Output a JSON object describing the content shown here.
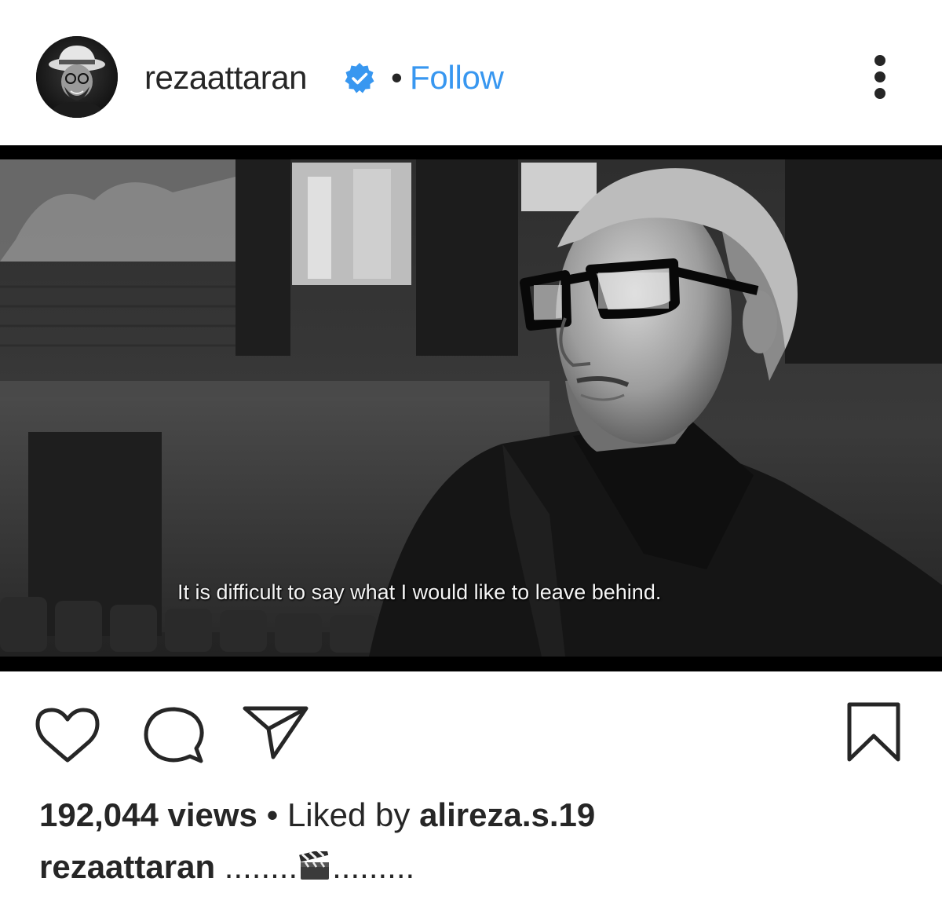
{
  "header": {
    "username": "rezaattaran",
    "verified": true,
    "separator": "•",
    "follow_label": "Follow",
    "more_icon": "more-vertical-icon",
    "accent_color": "#3897f0"
  },
  "media": {
    "type": "video",
    "style": "black-and-white",
    "subtitle": "It is difficult to say what I would like to leave behind."
  },
  "actions": {
    "like_icon": "heart-icon",
    "comment_icon": "comment-bubble-icon",
    "share_icon": "paper-plane-icon",
    "save_icon": "bookmark-icon"
  },
  "stats": {
    "views": "192,044 views",
    "separator": " • ",
    "liked_by_prefix": "Liked by ",
    "liked_by_user": "alireza.s.19"
  },
  "caption": {
    "username": "rezaattaran",
    "text_before": " ........",
    "emoji_icon": "clapper-board-icon",
    "text_after": "........."
  }
}
